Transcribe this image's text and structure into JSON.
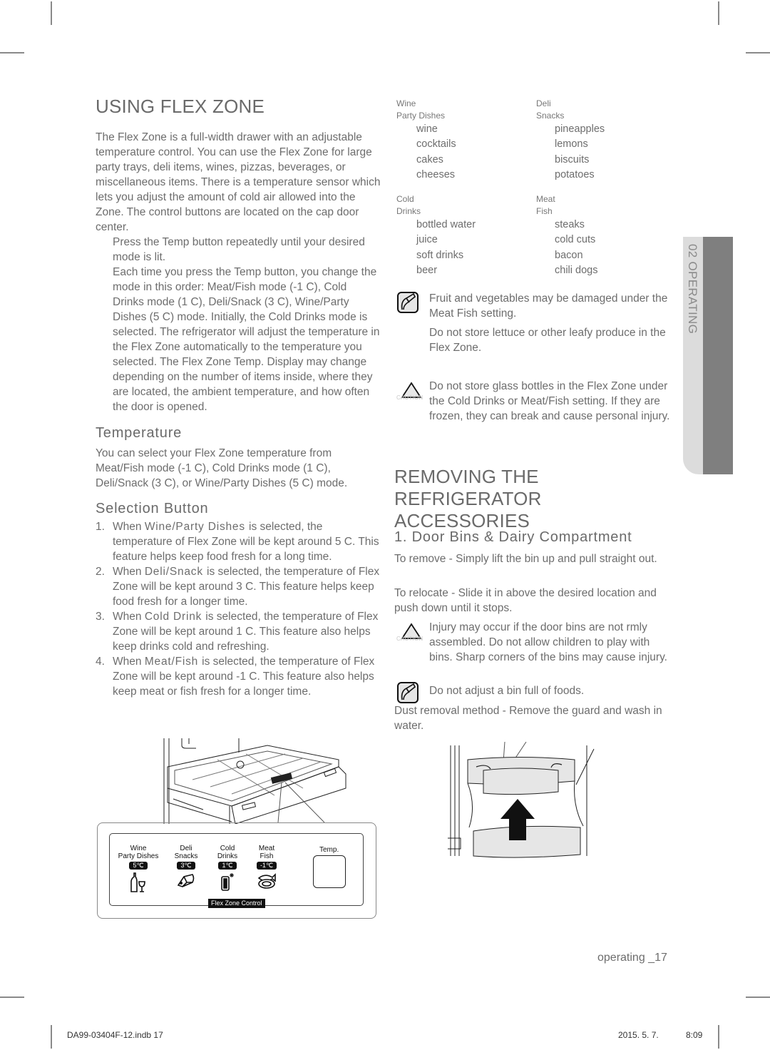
{
  "left": {
    "title": "USING FLEX ZONE",
    "intro": "The Flex Zone is a full-width drawer with an adjustable temperature control. You can use the Flex Zone for large party trays, deli items, wines, pizzas, beverages, or miscellaneous items. There is a temperature sensor which lets you adjust the amount of cold air allowed into the Zone. The control buttons are located on the cap door center.",
    "step1": "Press the Temp button repeatedly until your desired mode is lit.",
    "step2": "Each time you press the Temp button, you change the mode in this order: Meat/Fish mode (-1  C), Cold Drinks mode (1  C), Deli/Snack (3  C), Wine/Party Dishes (5  C) mode. Initially, the Cold Drinks mode is selected. The refrigerator will adjust the temperature in the Flex Zone automatically to the temperature you selected. The Flex Zone Temp. Display may change depending on the number of items inside, where they are located, the ambient temperature, and how often the door is opened.",
    "temperature_heading": "Temperature",
    "temperature_text": "You can select your Flex Zone temperature from Meat/Fish mode (-1  C), Cold Drinks mode (1  C), Deli/Snack (3  C), or Wine/Party Dishes (5  C) mode.",
    "selection_heading": "Selection Button",
    "selection_items": [
      {
        "num": "1.",
        "pre": "When ",
        "mode": " Wine/Party Dishes ",
        "post": " is selected, the temperature of Flex Zone will be kept around 5  C. This feature helps keep food fresh for a long time."
      },
      {
        "num": "2.",
        "pre": "When ",
        "mode": " Deli/Snack ",
        "post": " is selected, the temperature of Flex Zone will be kept around 3  C. This feature helps keep food fresh for a longer time."
      },
      {
        "num": "3.",
        "pre": "When ",
        "mode": " Cold Drink ",
        "post": " is selected, the temperature of Flex Zone will be kept around 1  C. This feature also helps keep drinks cold and refreshing."
      },
      {
        "num": "4.",
        "pre": "When ",
        "mode": " Meat/Fish ",
        "post": " is selected, the temperature of Flex Zone will be kept around -1  C. This feature also helps keep meat or fish fresh for a longer time."
      }
    ]
  },
  "food_table": [
    {
      "head1": "Wine",
      "head2": "Party Dishes",
      "items": [
        "wine",
        "cocktails",
        "cakes",
        "cheeses"
      ]
    },
    {
      "head1": "Deli",
      "head2": "Snacks",
      "items": [
        "pineapples",
        "lemons",
        "biscuits",
        "potatoes"
      ]
    },
    {
      "head1": "Cold",
      "head2": "Drinks",
      "items": [
        "bottled water",
        "juice",
        "soft drinks",
        "beer"
      ]
    },
    {
      "head1": "Meat",
      "head2": "Fish",
      "items": [
        "steaks",
        "cold cuts",
        "bacon",
        "chili dogs"
      ]
    }
  ],
  "notes": {
    "note1": "Fruit and vegetables may be damaged under the  Meat Fish  setting.",
    "note1b": "Do not store lettuce or other leafy produce in the Flex Zone.",
    "caution1": "Do not store glass bottles in the Flex Zone under the  Cold Drinks  or  Meat/Fish setting. If they are frozen, they can break and cause personal injury.",
    "caution_label": "CAUTION"
  },
  "right": {
    "title_line1": "REMOVING THE",
    "title_line2": "REFRIGERATOR ACCESSORIES",
    "section_heading": "1. Door Bins & Dairy Compartment",
    "remove_text": "To remove - Simply lift the bin up and pull straight out.",
    "relocate_text": "To relocate - Slide it in above the desired location and push down until it stops.",
    "caution2": "Injury may occur if the door bins are not   rmly assembled. Do not allow children to play with bins. Sharp corners of the bins may cause injury.",
    "note2": "Do not adjust a bin full of foods.",
    "dust_text": "Dust removal method - Remove the guard and wash in water."
  },
  "side_tab": {
    "label": "02  OPERATING"
  },
  "control_panel": {
    "modes": [
      {
        "line1": "Wine",
        "line2": "Party Dishes",
        "temp": "5℃",
        "icon": "wine-bottle-glass-icon"
      },
      {
        "line1": "Deli",
        "line2": "Snacks",
        "temp": "3℃",
        "icon": "cheese-icon"
      },
      {
        "line1": "Cold",
        "line2": "Drinks",
        "temp": "1℃",
        "icon": "can-cold-icon"
      },
      {
        "line1": "Meat",
        "line2": "Fish",
        "temp": "-1℃",
        "icon": "meat-fish-icon"
      }
    ],
    "temp_label": "Temp.",
    "footer_label": "Flex Zone Control"
  },
  "footer": {
    "page_label": "operating _17",
    "file": "DA99-03404F-12.indb   17",
    "date": "2015. 5. 7.",
    "time": "8:09"
  }
}
